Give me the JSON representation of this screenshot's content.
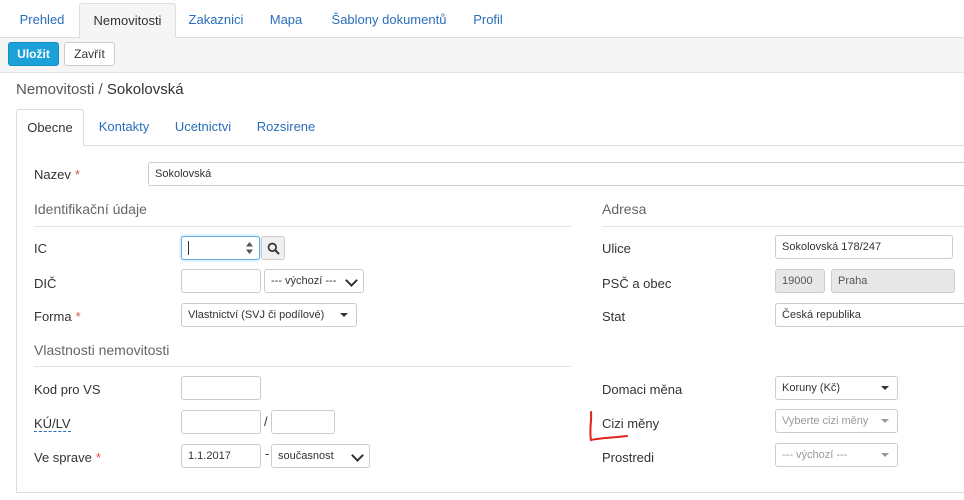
{
  "topnav": {
    "tabs": [
      "Prehled",
      "Nemovitosti",
      "Zakaznici",
      "Mapa",
      "Šablony dokumentů",
      "Profil"
    ],
    "active": "Nemovitosti"
  },
  "toolbar": {
    "save_label": "Uložit",
    "close_label": "Zavřít"
  },
  "breadcrumb": {
    "section": "Nemovitosti",
    "separator": "/",
    "current": "Sokolovská"
  },
  "subtabs": [
    "Obecne",
    "Kontakty",
    "Ucetnictvi",
    "Rozsirene"
  ],
  "form": {
    "name_label": "Nazev",
    "name_value": "Sokolovská",
    "required_mark": "*",
    "identification": {
      "heading": "Identifikační údaje",
      "ic_label": "IC",
      "ic_value": "",
      "dic_label": "DIČ",
      "dic_value": "",
      "dic_select": "--- výchozí ---",
      "forma_label": "Forma",
      "forma_value": "Vlastnictví (SVJ či podílové)"
    },
    "properties": {
      "heading": "Vlastnosti nemovitosti",
      "kod_label": "Kod pro VS",
      "kod_value": "",
      "kulv_label": "KÚ/LV",
      "ku_value": "",
      "lv_value": "",
      "slash": "/",
      "sprava_label": "Ve sprave",
      "sprava_from": "1.1.2017",
      "dash": "-",
      "sprava_to": "současnost"
    },
    "address": {
      "heading": "Adresa",
      "ulice_label": "Ulice",
      "ulice_value": "Sokolovská 178/247",
      "psc_label": "PSČ a obec",
      "psc_value": "19000",
      "obec_value": "Praha",
      "stat_label": "Stat",
      "stat_value": "Česká republika"
    },
    "currency": {
      "domaci_label": "Domaci měna",
      "domaci_value": "Koruny (Kč)",
      "cizi_label": "Cizi měny",
      "cizi_placeholder": "Vyberte cizi měny",
      "prostredi_label": "Prostredi",
      "prostredi_value": "--- výchozí ---"
    }
  },
  "colors": {
    "accent": "#1ba1d8",
    "link": "#2a6ebb",
    "required": "#d9534f",
    "annotation": "#e2231a"
  }
}
